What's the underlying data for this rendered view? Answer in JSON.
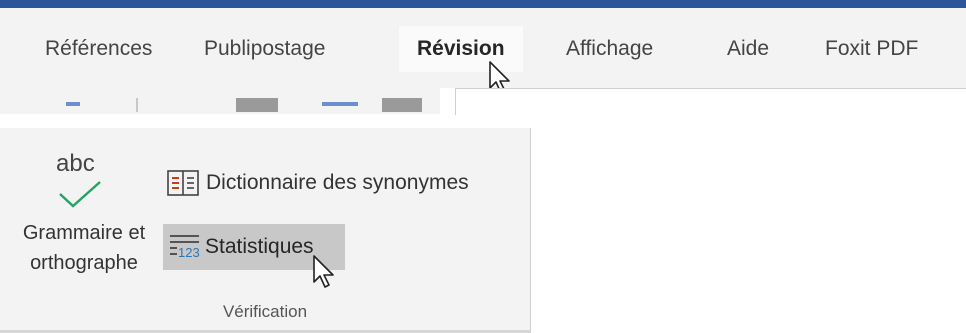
{
  "ribbon": {
    "accent_color": "#2b579a",
    "tabs": [
      {
        "label": "Références"
      },
      {
        "label": "Publipostage"
      },
      {
        "label": "Révision",
        "active": true
      },
      {
        "label": "Affichage"
      },
      {
        "label": "Aide"
      },
      {
        "label": "Foxit PDF"
      }
    ]
  },
  "proofing_group": {
    "group_label": "Vérification",
    "spelling": {
      "icon_text": "abc",
      "label_line1": "Grammaire et",
      "label_line2": "orthographe",
      "icon": "checkmark-icon",
      "check_color": "#21a366"
    },
    "thesaurus": {
      "label": "Dictionnaire des synonymes",
      "icon": "book-icon"
    },
    "word_count": {
      "label": "Statistiques",
      "icon": "word-count-icon",
      "icon_digits": "123",
      "icon_color": "#2e75b6",
      "hovered": true
    }
  },
  "cursor": {
    "icon": "mouse-pointer-icon"
  }
}
